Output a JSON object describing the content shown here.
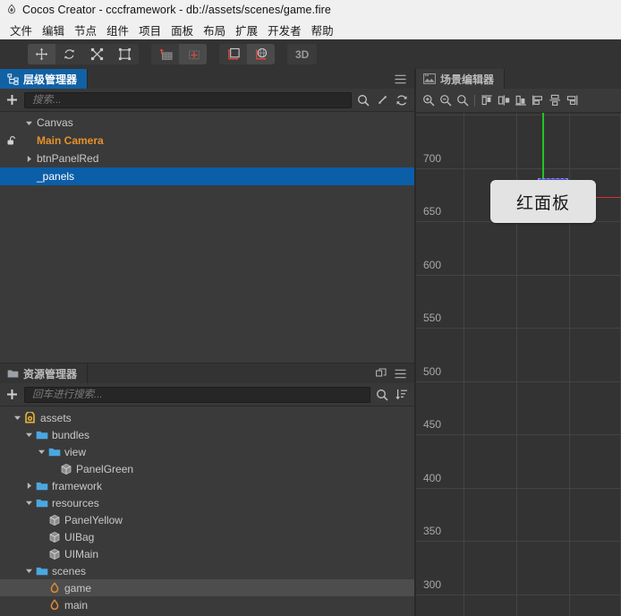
{
  "window": {
    "title": "Cocos Creator - cccframework - db://assets/scenes/game.fire",
    "logo_icon": "cocos-logo-icon"
  },
  "menubar": {
    "items": [
      {
        "label": "文件"
      },
      {
        "label": "编辑"
      },
      {
        "label": "节点"
      },
      {
        "label": "组件"
      },
      {
        "label": "项目"
      },
      {
        "label": "面板"
      },
      {
        "label": "布局"
      },
      {
        "label": "扩展"
      },
      {
        "label": "开发者"
      },
      {
        "label": "帮助"
      }
    ]
  },
  "toolbar": {
    "transform_tools": [
      {
        "name": "move-tool",
        "selected": true
      },
      {
        "name": "rotate-tool",
        "selected": false
      },
      {
        "name": "scale-tool",
        "selected": false
      },
      {
        "name": "rect-tool",
        "selected": false
      }
    ],
    "pivot_tools": [
      {
        "name": "pivot-tool",
        "selected": false
      },
      {
        "name": "center-tool",
        "selected": true
      }
    ],
    "coord_tools": [
      {
        "name": "local-coord-tool",
        "selected": false
      },
      {
        "name": "global-coord-tool",
        "selected": true
      }
    ],
    "mode_3d_label": "3D"
  },
  "hierarchy": {
    "tab_label": "层级管理器",
    "tab_icon": "hierarchy-icon",
    "menu_icon": "hamburger-menu-icon",
    "add_icon": "plus-icon",
    "search": {
      "placeholder": "搜索...",
      "value": ""
    },
    "search_icon": "search-icon",
    "locate_icon": "locate-node-icon",
    "refresh_icon": "refresh-icon",
    "nodes": [
      {
        "label": "Canvas",
        "depth": 1,
        "arrow": "down",
        "style": "normal",
        "selected": false,
        "lock": false
      },
      {
        "label": "Main Camera",
        "depth": 2,
        "arrow": "none",
        "style": "orange",
        "selected": false,
        "lock": true
      },
      {
        "label": "btnPanelRed",
        "depth": 2,
        "arrow": "right",
        "style": "normal",
        "selected": false,
        "lock": false
      },
      {
        "label": "_panels",
        "depth": 2,
        "arrow": "none",
        "style": "normal",
        "selected": true,
        "lock": false
      }
    ]
  },
  "assets": {
    "tab_label": "资源管理器",
    "tab_icon": "folder-icon",
    "popout_icon": "popout-icon",
    "menu_icon": "hamburger-menu-icon",
    "add_icon": "plus-icon",
    "search": {
      "placeholder": "回车进行搜索...",
      "value": ""
    },
    "search_icon": "search-icon",
    "sort_icon": "sort-icon",
    "nodes": [
      {
        "label": "assets",
        "depth": 1,
        "arrow": "down",
        "icon": "assets-db-icon",
        "current": false
      },
      {
        "label": "bundles",
        "depth": 2,
        "arrow": "down",
        "icon": "folder-icon",
        "current": false
      },
      {
        "label": "view",
        "depth": 3,
        "arrow": "down",
        "icon": "folder-icon",
        "current": false
      },
      {
        "label": "PanelGreen",
        "depth": 4,
        "arrow": "none",
        "icon": "prefab-icon",
        "current": false
      },
      {
        "label": "framework",
        "depth": 2,
        "arrow": "right",
        "icon": "folder-icon",
        "current": false
      },
      {
        "label": "resources",
        "depth": 2,
        "arrow": "down",
        "icon": "folder-icon",
        "current": false
      },
      {
        "label": "PanelYellow",
        "depth": 3,
        "arrow": "none",
        "icon": "prefab-icon",
        "current": false
      },
      {
        "label": "UIBag",
        "depth": 3,
        "arrow": "none",
        "icon": "prefab-icon",
        "current": false
      },
      {
        "label": "UIMain",
        "depth": 3,
        "arrow": "none",
        "icon": "prefab-icon",
        "current": false
      },
      {
        "label": "scenes",
        "depth": 2,
        "arrow": "down",
        "icon": "folder-icon",
        "current": false
      },
      {
        "label": "game",
        "depth": 3,
        "arrow": "none",
        "icon": "scene-icon",
        "current": true
      },
      {
        "label": "main",
        "depth": 3,
        "arrow": "none",
        "icon": "scene-icon",
        "current": false
      }
    ]
  },
  "scene": {
    "tab_label": "场景编辑器",
    "tab_icon": "scene-editor-icon",
    "tools": [
      {
        "name": "zoom-in-icon"
      },
      {
        "name": "zoom-out-icon"
      },
      {
        "name": "zoom-fit-icon"
      },
      {
        "name": "align-left-icon"
      },
      {
        "name": "align-horizontal-center-icon"
      },
      {
        "name": "align-right-icon"
      },
      {
        "name": "align-top-icon"
      },
      {
        "name": "align-vertical-center-icon"
      },
      {
        "name": "align-bottom-icon"
      }
    ],
    "ruler_labels": [
      "700",
      "650",
      "600",
      "550",
      "500",
      "450",
      "400",
      "350",
      "300"
    ],
    "node_button_label": "红面板",
    "colors": {
      "axis_y": "#21c521",
      "axis_x": "#d83030",
      "selection_rect": "#5656dc",
      "panel_bg": "#e3e3e3",
      "accent": "#1161a5"
    }
  }
}
